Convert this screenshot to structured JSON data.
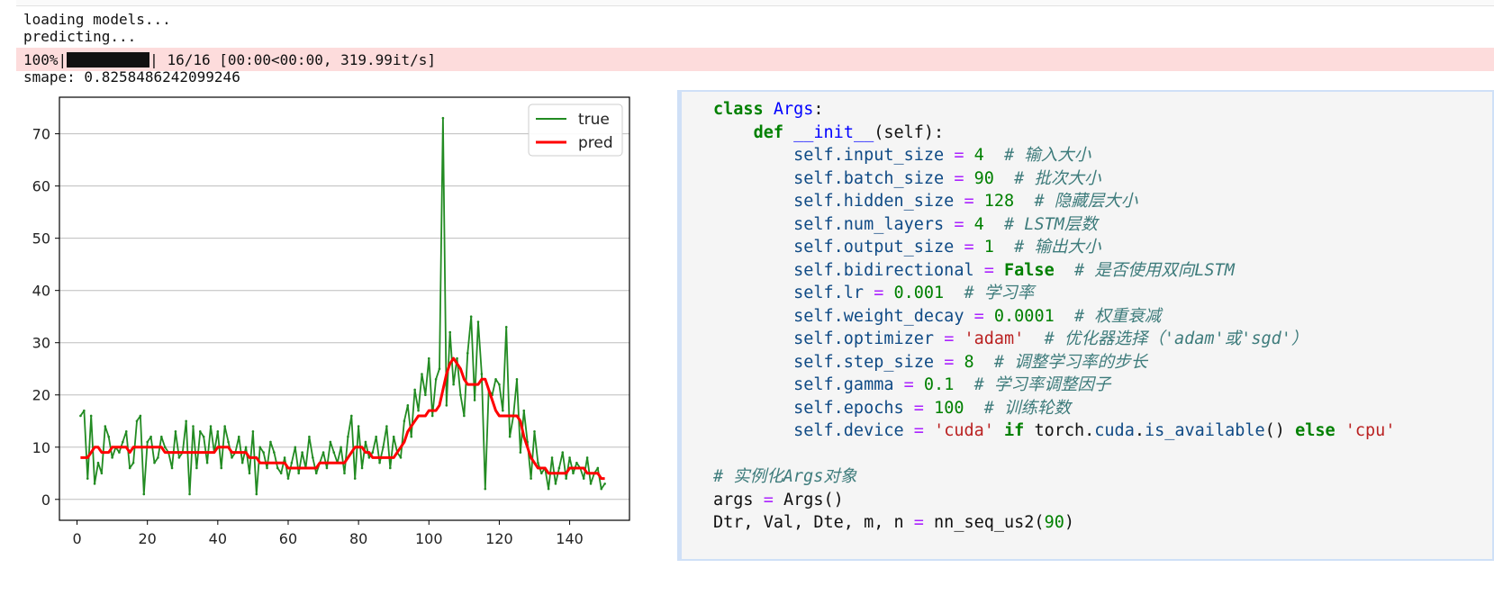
{
  "output": {
    "line1": "loading models...",
    "line2": "predicting...",
    "progress": {
      "percent_label": "100%|",
      "after_bar": "| 16/16 [00:00<00:00, 319.99it/s]",
      "fraction": 1.0
    },
    "smape": "smape: 0.8258486242099246"
  },
  "chart_data": {
    "type": "line",
    "x": [
      1,
      2,
      3,
      4,
      5,
      6,
      7,
      8,
      9,
      10,
      11,
      12,
      13,
      14,
      15,
      16,
      17,
      18,
      19,
      20,
      21,
      22,
      23,
      24,
      25,
      26,
      27,
      28,
      29,
      30,
      31,
      32,
      33,
      34,
      35,
      36,
      37,
      38,
      39,
      40,
      41,
      42,
      43,
      44,
      45,
      46,
      47,
      48,
      49,
      50,
      51,
      52,
      53,
      54,
      55,
      56,
      57,
      58,
      59,
      60,
      61,
      62,
      63,
      64,
      65,
      66,
      67,
      68,
      69,
      70,
      71,
      72,
      73,
      74,
      75,
      76,
      77,
      78,
      79,
      80,
      81,
      82,
      83,
      84,
      85,
      86,
      87,
      88,
      89,
      90,
      91,
      92,
      93,
      94,
      95,
      96,
      97,
      98,
      99,
      100,
      101,
      102,
      103,
      104,
      105,
      106,
      107,
      108,
      109,
      110,
      111,
      112,
      113,
      114,
      115,
      116,
      117,
      118,
      119,
      120,
      121,
      122,
      123,
      124,
      125,
      126,
      127,
      128,
      129,
      130,
      131,
      132,
      133,
      134,
      135,
      136,
      137,
      138,
      139,
      140,
      141,
      142,
      143,
      144,
      145,
      146,
      147,
      148,
      149,
      150
    ],
    "series": [
      {
        "name": "true",
        "color": "#228b22",
        "values": [
          16,
          17,
          4,
          16,
          3,
          7,
          5,
          14,
          12,
          8,
          10,
          9,
          11,
          13,
          6,
          7,
          15,
          16,
          1,
          11,
          12,
          7,
          8,
          12,
          10,
          9,
          6,
          13,
          8,
          9,
          15,
          1,
          14,
          6,
          13,
          12,
          7,
          14,
          9,
          13,
          6,
          14,
          11,
          8,
          9,
          12,
          7,
          10,
          5,
          13,
          1,
          10,
          9,
          6,
          11,
          9,
          6,
          5,
          8,
          4,
          7,
          10,
          5,
          9,
          6,
          12,
          8,
          5,
          7,
          9,
          6,
          11,
          9,
          7,
          10,
          5,
          12,
          16,
          4,
          14,
          6,
          11,
          8,
          9,
          12,
          7,
          10,
          14,
          6,
          12,
          9,
          8,
          15,
          18,
          12,
          21,
          17,
          24,
          20,
          27,
          16,
          23,
          25,
          73,
          18,
          32,
          22,
          27,
          20,
          16,
          28,
          35,
          19,
          34,
          24,
          2,
          21,
          20,
          23,
          22,
          17,
          33,
          12,
          16,
          23,
          9,
          17,
          11,
          4,
          13,
          7,
          5,
          6,
          2,
          8,
          3,
          6,
          9,
          4,
          8,
          5,
          7,
          6,
          4,
          8,
          3,
          5,
          6,
          2,
          3
        ]
      },
      {
        "name": "pred",
        "color": "#ff0000",
        "values": [
          8,
          8,
          8,
          9,
          10,
          10,
          9,
          9,
          9,
          10,
          10,
          10,
          10,
          10,
          9,
          10,
          10,
          10,
          10,
          10,
          10,
          10,
          10,
          10,
          9,
          9,
          9,
          9,
          9,
          9,
          9,
          9,
          9,
          9,
          9,
          9,
          9,
          9,
          9,
          10,
          10,
          10,
          10,
          9,
          9,
          9,
          9,
          9,
          8,
          8,
          8,
          7,
          7,
          7,
          7,
          7,
          7,
          7,
          7,
          6,
          6,
          6,
          6,
          6,
          6,
          6,
          6,
          6,
          7,
          7,
          7,
          7,
          7,
          7,
          7,
          7,
          8,
          9,
          10,
          10,
          10,
          9,
          9,
          8,
          8,
          8,
          8,
          8,
          8,
          8,
          9,
          10,
          11,
          13,
          14,
          15,
          16,
          16,
          16,
          17,
          17,
          17,
          18,
          21,
          24,
          26,
          27,
          26,
          25,
          23,
          22,
          22,
          22,
          22,
          23,
          23,
          21,
          19,
          17,
          16,
          16,
          16,
          16,
          16,
          16,
          15,
          12,
          10,
          8,
          7,
          6,
          6,
          6,
          5,
          5,
          5,
          5,
          5,
          5,
          6,
          6,
          6,
          6,
          6,
          5,
          5,
          5,
          5,
          4,
          4
        ]
      }
    ],
    "xticks": [
      0,
      20,
      40,
      60,
      80,
      100,
      120,
      140
    ],
    "yticks": [
      0,
      10,
      20,
      30,
      40,
      50,
      60,
      70
    ],
    "xlim": [
      -5,
      157
    ],
    "ylim": [
      -4,
      77
    ],
    "grid": "horizontal",
    "legend_position": "upper right"
  },
  "code": {
    "l1_kw": "class",
    "l1_name": "Args",
    "l1_colon": ":",
    "l2_kw": "def",
    "l2_fn": "__init__",
    "l2_rest": "(self):",
    "l3_attr": "self.input_size",
    "l3_val": "4",
    "l3_cm": "# 输入大小",
    "l4_attr": "self.batch_size",
    "l4_val": "90",
    "l4_cm": "# 批次大小",
    "l5_attr": "self.hidden_size",
    "l5_val": "128",
    "l5_cm": "# 隐藏层大小",
    "l6_attr": "self.num_layers",
    "l6_val": "4",
    "l6_cm": "# LSTM层数",
    "l7_attr": "self.output_size",
    "l7_val": "1",
    "l7_cm": "# 输出大小",
    "l8_attr": "self.bidirectional",
    "l8_val": "False",
    "l8_cm": "# 是否使用双向LSTM",
    "l9_attr": "self.lr",
    "l9_val": "0.001",
    "l9_cm": "# 学习率",
    "l10_attr": "self.weight_decay",
    "l10_val": "0.0001",
    "l10_cm": "# 权重衰减",
    "l11_attr": "self.optimizer",
    "l11_val": "'adam'",
    "l11_cm": "# 优化器选择（'adam'或'sgd'）",
    "l12_attr": "self.step_size",
    "l12_val": "8",
    "l12_cm": "# 调整学习率的步长",
    "l13_attr": "self.gamma",
    "l13_val": "0.1",
    "l13_cm": "# 学习率调整因子",
    "l14_attr": "self.epochs",
    "l14_val": "100",
    "l14_cm": "# 训练轮数",
    "l15_attr": "self.device",
    "l15_val1": "'cuda'",
    "l15_if": "if",
    "l15_mid1": "torch.",
    "l15_cuda": "cuda",
    "l15_mid2": ".",
    "l15_fn": "is_available",
    "l15_paren": "()",
    "l15_else": "else",
    "l15_val2": "'cpu'",
    "l17_cm": "# 实例化Args对象",
    "l18_a": "args",
    "l18_b": "Args()",
    "l19_a": "Dtr, Val, Dte, m, n",
    "l19_fn": "nn_seq_us2(",
    "l19_num": "90",
    "l19_end": ")",
    "eq": "="
  }
}
